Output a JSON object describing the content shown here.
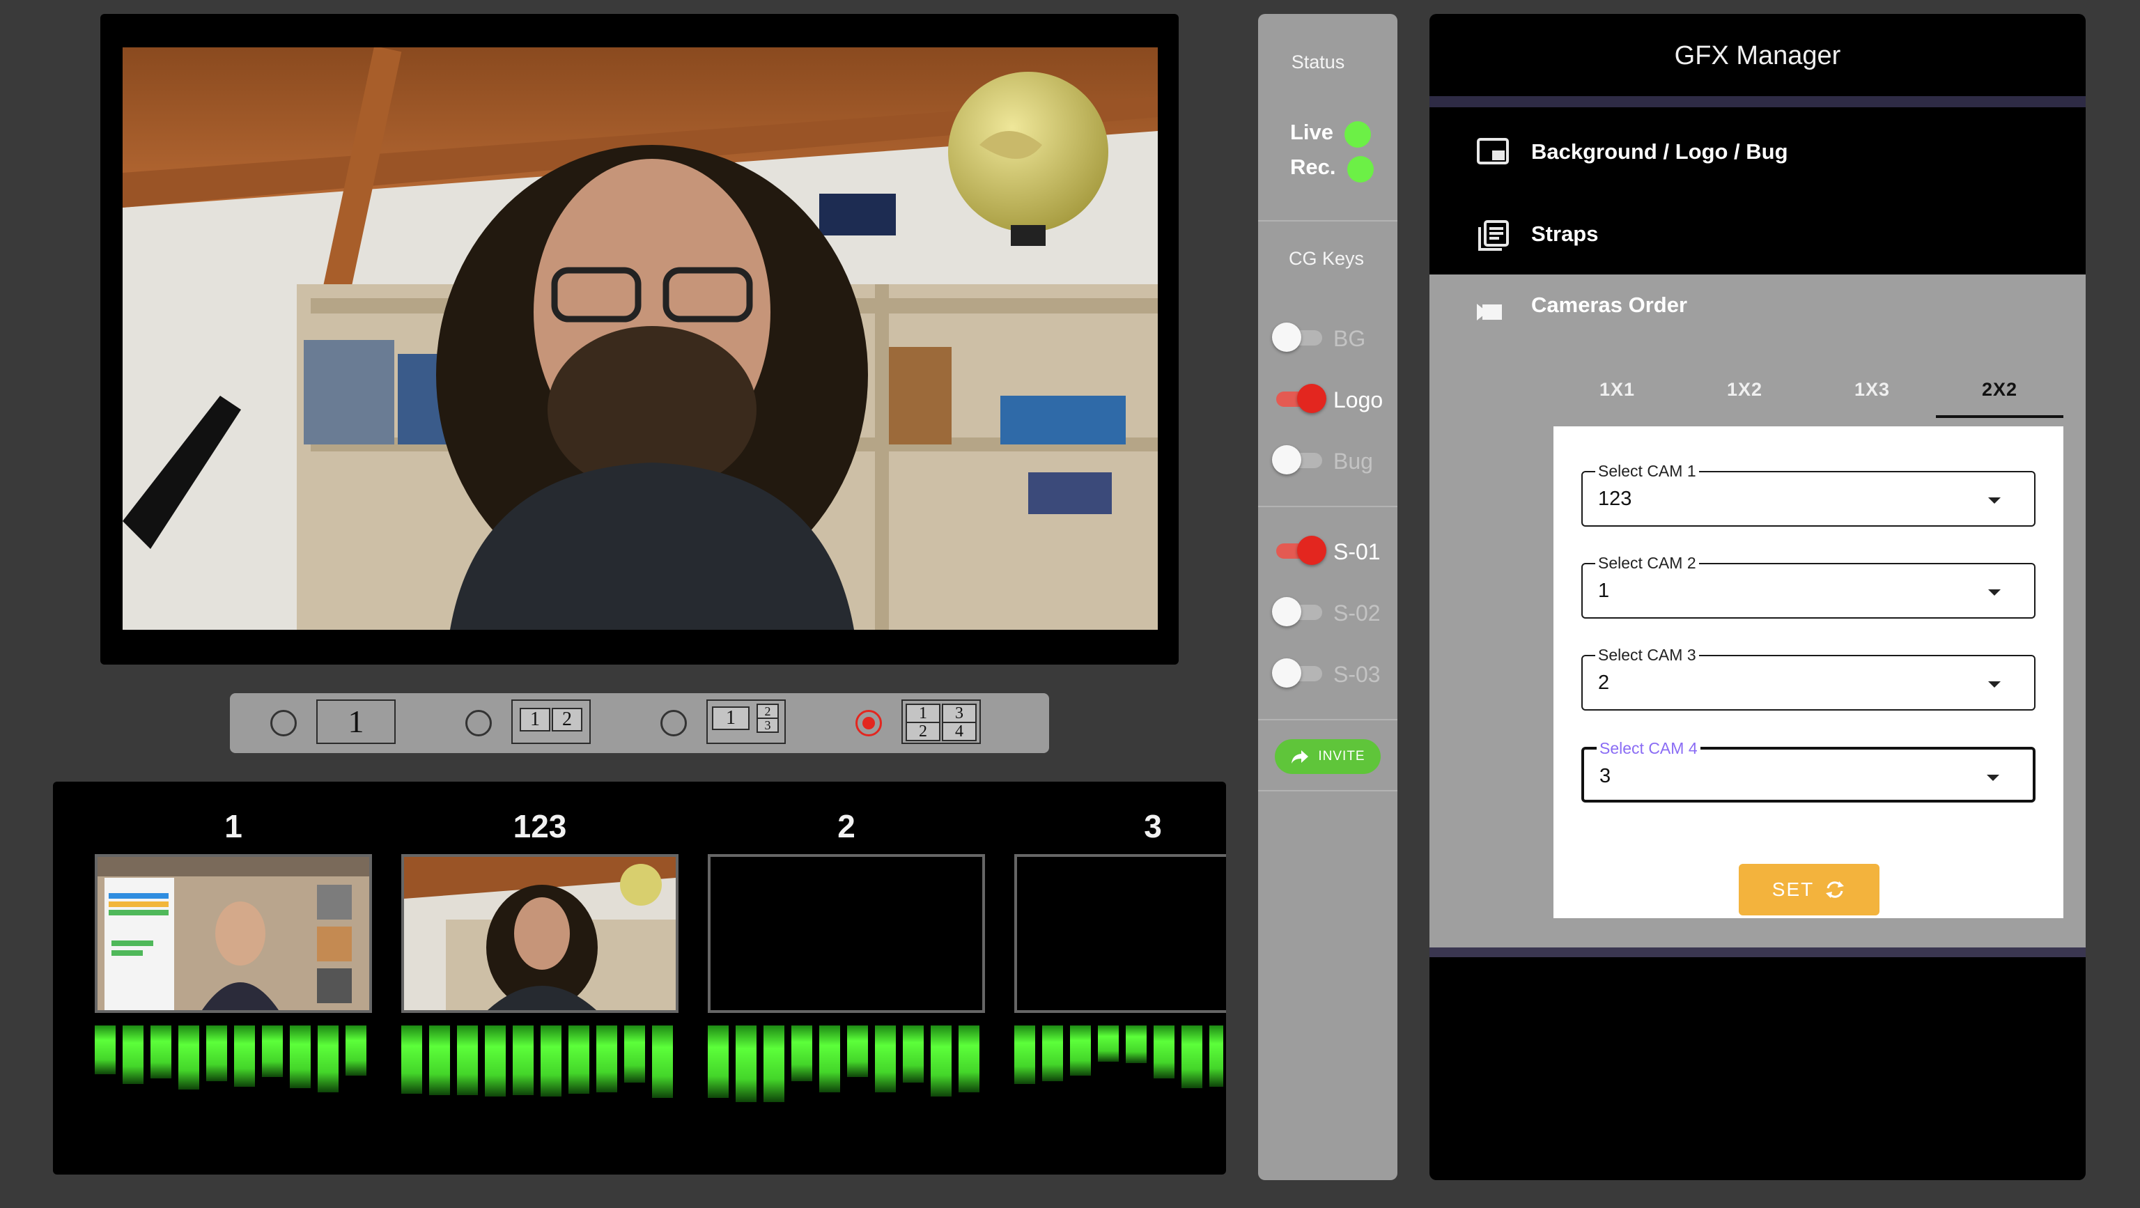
{
  "layouts": [
    {
      "selected": false,
      "cells": [
        "1"
      ]
    },
    {
      "selected": false,
      "cells": [
        "1",
        "2"
      ]
    },
    {
      "selected": false,
      "cells": [
        "1",
        "2",
        "3"
      ]
    },
    {
      "selected": true,
      "cells": [
        "1",
        "2",
        "3",
        "4"
      ]
    }
  ],
  "thumbnails": [
    {
      "label": "1"
    },
    {
      "label": "123"
    },
    {
      "label": "2"
    },
    {
      "label": "3"
    }
  ],
  "status": {
    "heading": "Status",
    "live_label": "Live",
    "rec_label": "Rec.",
    "live_color": "#6cf046",
    "rec_color": "#6cf046"
  },
  "cg_keys": {
    "heading": "CG Keys",
    "toggles": [
      {
        "label": "BG",
        "on": false
      },
      {
        "label": "Logo",
        "on": true
      },
      {
        "label": "Bug",
        "on": false
      }
    ]
  },
  "straps": {
    "toggles": [
      {
        "label": "S-01",
        "on": true
      },
      {
        "label": "S-02",
        "on": false
      },
      {
        "label": "S-03",
        "on": false
      }
    ]
  },
  "invite_label": "INVITE",
  "gfx": {
    "title": "GFX Manager",
    "menu": [
      {
        "label": "Background / Logo / Bug",
        "icon": "picture-in-picture-icon"
      },
      {
        "label": "Straps",
        "icon": "library-books-icon"
      },
      {
        "label": "Cameras Order",
        "icon": "videocam-icon"
      }
    ],
    "tabs": [
      {
        "label": "1X1",
        "active": false
      },
      {
        "label": "1X2",
        "active": false
      },
      {
        "label": "1X3",
        "active": false
      },
      {
        "label": "2X2",
        "active": true
      }
    ],
    "fields": [
      {
        "label": "Select CAM 1",
        "value": "123",
        "focused": false
      },
      {
        "label": "Select CAM 2",
        "value": "1",
        "focused": false
      },
      {
        "label": "Select CAM 3",
        "value": "2",
        "focused": false
      },
      {
        "label": "Select CAM 4",
        "value": "3",
        "focused": true
      }
    ],
    "set_label": "SET"
  },
  "colors": {
    "accent_red": "#e3261f",
    "live_green": "#6cf046",
    "set_yellow": "#f3b33d",
    "focus_purple": "#8a6cf4",
    "invite_green": "#5fc53a"
  }
}
